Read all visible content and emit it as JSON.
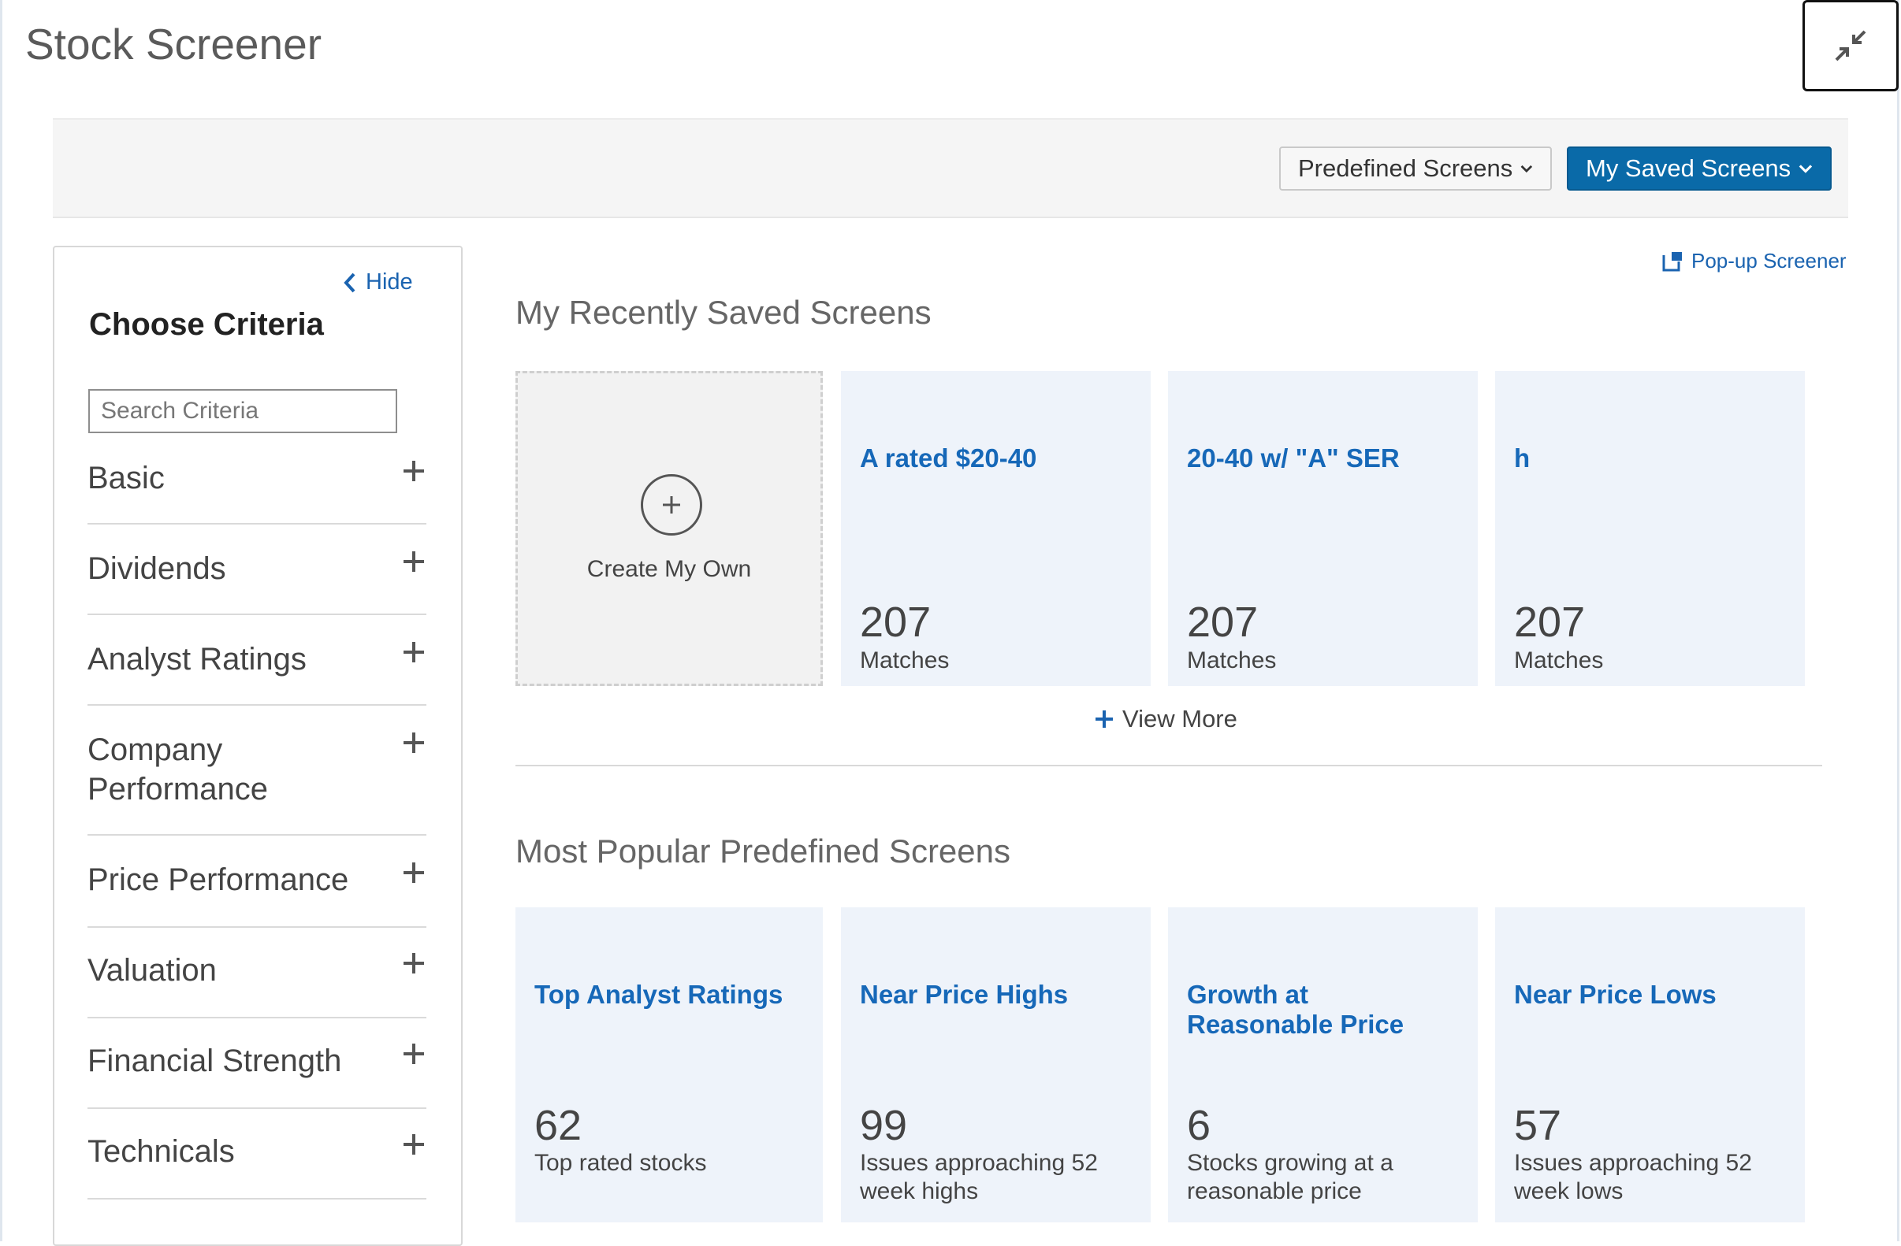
{
  "header": {
    "title": "Stock Screener",
    "collapse_icon": "collapse-arrows-icon"
  },
  "toolbar": {
    "predefined_label": "Predefined Screens",
    "saved_label": "My Saved Screens"
  },
  "criteria_panel": {
    "hide_label": "Hide",
    "title": "Choose Criteria",
    "search_placeholder": "Search Criteria",
    "items": [
      "Basic",
      "Dividends",
      "Analyst Ratings",
      "Company Performance",
      "Price Performance",
      "Valuation",
      "Financial Strength",
      "Technicals"
    ]
  },
  "main": {
    "popup_label": "Pop-up Screener",
    "recent_title": "My Recently Saved Screens",
    "create_label": "Create My Own",
    "recent_cards": [
      {
        "title": "A rated $20-40",
        "count": "207",
        "sub": "Matches"
      },
      {
        "title": "20-40 w/ \"A\" SER",
        "count": "207",
        "sub": "Matches"
      },
      {
        "title": "h",
        "count": "207",
        "sub": "Matches"
      }
    ],
    "view_more_label": "View More",
    "popular_title": "Most Popular Predefined Screens",
    "popular_cards": [
      {
        "title": "Top Analyst Ratings",
        "count": "62",
        "sub": "Top rated stocks"
      },
      {
        "title": "Near Price Highs",
        "count": "99",
        "sub": "Issues approaching 52 week highs"
      },
      {
        "title": "Growth at Reasonable Price",
        "count": "6",
        "sub": "Stocks growing at a reasonable price"
      },
      {
        "title": "Near Price Lows",
        "count": "57",
        "sub": "Issues approaching 52 week lows"
      }
    ]
  },
  "colors": {
    "accent": "#0a6aa8",
    "link": "#1668b8",
    "card_bg": "#eef3fa"
  }
}
